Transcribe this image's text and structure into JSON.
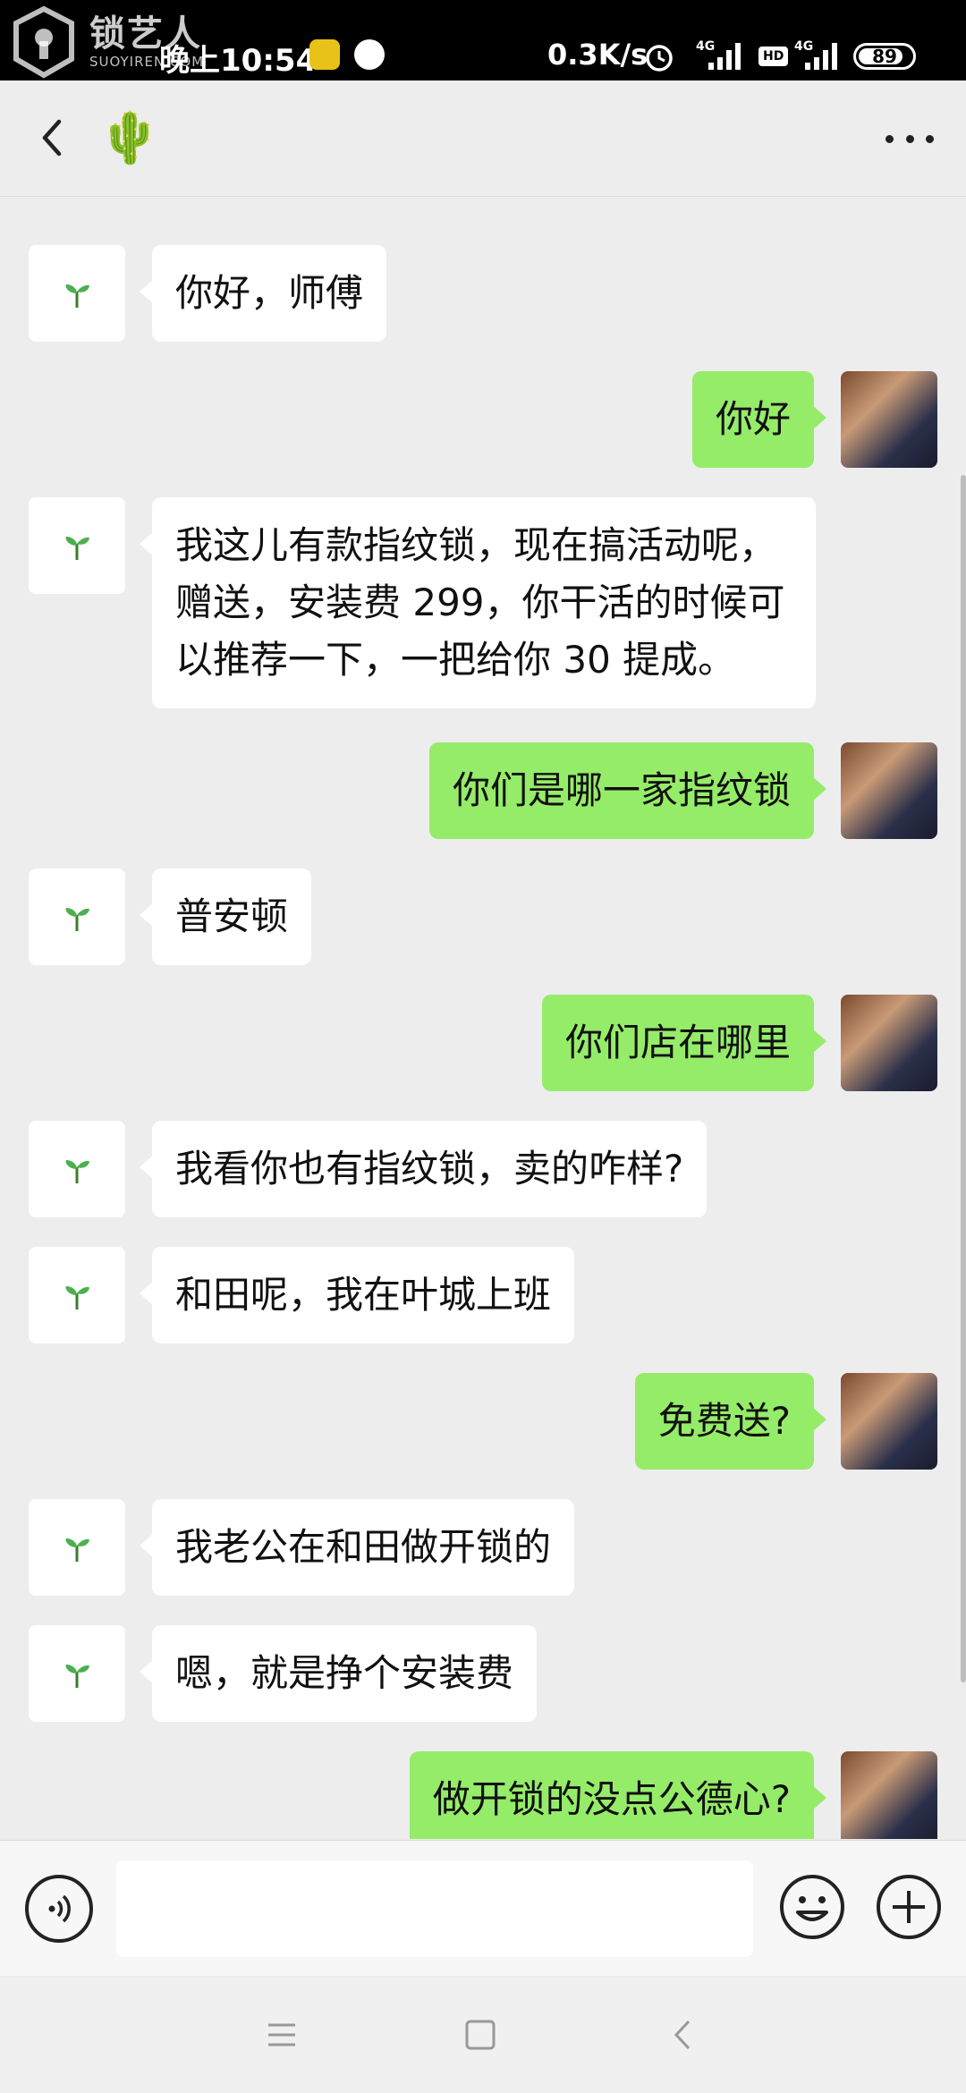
{
  "status_bar": {
    "watermark_cn": "锁艺人",
    "watermark_en": "SUOYIREN.COM",
    "time": "晚上10:54",
    "net_speed": "0.3K/s",
    "net1": "4G",
    "net2": "HD",
    "net3": "4G",
    "battery": "89"
  },
  "header": {
    "contact_emoji": "🌵"
  },
  "avatars": {
    "left_emoji": "🌱"
  },
  "messages": [
    {
      "side": "left",
      "text": "你好，师傅"
    },
    {
      "side": "right",
      "text": "你好"
    },
    {
      "side": "left",
      "text": "我这儿有款指纹锁，现在搞活动呢，赠送，安装费 299，你干活的时候可以推荐一下，一把给你 30 提成。"
    },
    {
      "side": "right",
      "text": "你们是哪一家指纹锁"
    },
    {
      "side": "left",
      "text": "普安顿"
    },
    {
      "side": "right",
      "text": "你们店在哪里"
    },
    {
      "side": "left",
      "text": "我看你也有指纹锁，卖的咋样?"
    },
    {
      "side": "left",
      "text": "和田呢，我在叶城上班"
    },
    {
      "side": "right",
      "text": "免费送?"
    },
    {
      "side": "left",
      "text": "我老公在和田做开锁的"
    },
    {
      "side": "left",
      "text": "嗯，就是挣个安装费"
    },
    {
      "side": "right",
      "text": "做开锁的没点公德心?"
    }
  ],
  "input": {
    "placeholder": ""
  },
  "colors": {
    "self_bubble": "#95ec69",
    "other_bubble": "#ffffff",
    "background": "#ededed"
  }
}
